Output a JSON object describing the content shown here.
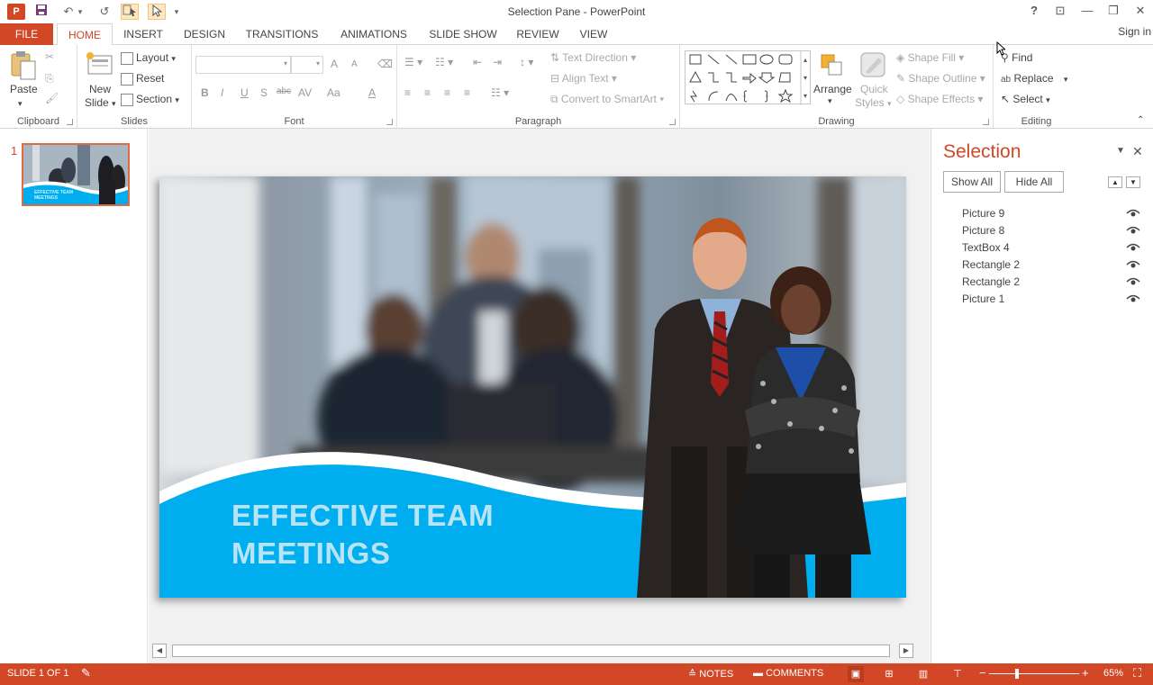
{
  "window": {
    "title": "Selection Pane - PowerPoint",
    "app_icon_label": "P",
    "help": "?",
    "restore_ribbon": "⊡",
    "minimize": "—",
    "maximize": "❐",
    "close": "✕"
  },
  "quick_access": {
    "save": "save-icon",
    "undo": "↶",
    "undo_drop": "▾",
    "redo": "↺",
    "customize": "▾"
  },
  "tabs": [
    {
      "label": "FILE"
    },
    {
      "label": "HOME"
    },
    {
      "label": "INSERT"
    },
    {
      "label": "DESIGN"
    },
    {
      "label": "TRANSITIONS"
    },
    {
      "label": "ANIMATIONS"
    },
    {
      "label": "SLIDE SHOW"
    },
    {
      "label": "REVIEW"
    },
    {
      "label": "VIEW"
    }
  ],
  "sign_in": "Sign in",
  "ribbon": {
    "clipboard": {
      "label": "Clipboard",
      "paste": "Paste"
    },
    "slides": {
      "label": "Slides",
      "new_slide_1": "New",
      "new_slide_2": "Slide",
      "layout": "Layout",
      "reset": "Reset",
      "section": "Section"
    },
    "font": {
      "label": "Font",
      "bold": "B",
      "italic": "I",
      "underline": "U",
      "shadow": "S",
      "strike": "abc",
      "spacing": "AV",
      "case": "Aa",
      "color": "A",
      "grow": "A",
      "shrink": "A"
    },
    "paragraph": {
      "label": "Paragraph",
      "text_direction": "Text Direction",
      "align_text": "Align Text",
      "convert": "Convert to SmartArt"
    },
    "drawing": {
      "label": "Drawing",
      "arrange": "Arrange",
      "quick_styles_1": "Quick",
      "quick_styles_2": "Styles",
      "shape_fill": "Shape Fill",
      "shape_outline": "Shape Outline",
      "shape_effects": "Shape Effects"
    },
    "editing": {
      "label": "Editing",
      "find": "Find",
      "replace": "Replace",
      "select": "Select"
    }
  },
  "thumbnails": [
    {
      "number": "1",
      "caption_1": "EFFECTIVE TEAM",
      "caption_2": "MEETINGS"
    }
  ],
  "slide": {
    "title_line1": "EFFECTIVE TEAM",
    "title_line2": "MEETINGS",
    "accent_color": "#00aeef"
  },
  "selection_pane": {
    "title": "Selection",
    "show_all": "Show All",
    "hide_all": "Hide All",
    "bring_forward": "▲",
    "send_backward": "▼",
    "items": [
      {
        "label": "Picture 9",
        "visible_icon": "eye-icon"
      },
      {
        "label": "Picture 8",
        "visible_icon": "eye-icon"
      },
      {
        "label": "TextBox 4",
        "visible_icon": "eye-icon"
      },
      {
        "label": "Rectangle 2",
        "visible_icon": "eye-icon"
      },
      {
        "label": "Rectangle 2",
        "visible_icon": "eye-icon"
      },
      {
        "label": "Picture 1",
        "visible_icon": "eye-icon"
      }
    ]
  },
  "statusbar": {
    "slide_info": "SLIDE 1 OF 1",
    "notes": "NOTES",
    "comments": "COMMENTS",
    "zoom_out": "−",
    "zoom_in": "+",
    "zoom": "65%"
  },
  "colors": {
    "brand": "#d24726",
    "slide_blue": "#00aeef"
  }
}
